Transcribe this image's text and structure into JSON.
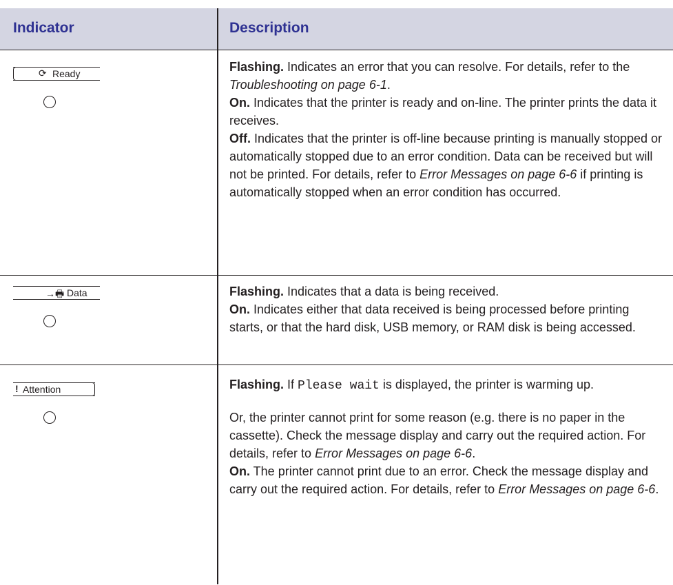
{
  "header": {
    "indicator": "Indicator",
    "description": "Description"
  },
  "rows": [
    {
      "panel_label": "Ready",
      "panel_icon": "ready-circle-icon",
      "desc": {
        "flashing_lead": "Flashing.",
        "flashing_text": " Indicates an error that you can resolve. For details, refer to the ",
        "flashing_ref": "Troubleshooting on page 6-1",
        "flashing_end": ".",
        "on_lead": "On.",
        "on_text": " Indicates that the printer is ready and on-line. The printer prints the data it receives.",
        "off_lead": "Off.",
        "off_text": " Indicates that the printer is off-line because printing is manually stopped or automatically stopped due to an error condition. Data can be received but will not be printed. For details, refer to ",
        "off_ref": "Error Messages on page 6-6",
        "off_end": " if printing is automatically stopped when an error condition has occurred."
      }
    },
    {
      "panel_label": "Data",
      "panel_icon": "data-printer-arrow-icon",
      "desc": {
        "flashing_lead": "Flashing.",
        "flashing_text": " Indicates that a data is being received.",
        "on_lead": "On.",
        "on_text": " Indicates either that data received is being processed before printing starts, or that the hard disk, USB memory, or RAM disk is being accessed."
      }
    },
    {
      "panel_label": "Attention",
      "panel_icon": "exclamation-icon",
      "desc": {
        "flashing_lead": "Flashing.",
        "flashing_text_a": " If ",
        "flashing_mono": "Please wait",
        "flashing_text_b": " is displayed, the printer is warming up.",
        "para2_text": "Or, the printer cannot print for some reason (e.g. there is no paper in the cassette). Check the message display and carry out the required action. For details, refer to ",
        "para2_ref": "Error Messages on page 6-6",
        "para2_end": ".",
        "on_lead": "On.",
        "on_text": " The printer cannot print due to an error. Check the message display and carry out the required action. For details, refer to ",
        "on_ref": "Error Messages on page 6-6",
        "on_end": "."
      }
    }
  ]
}
